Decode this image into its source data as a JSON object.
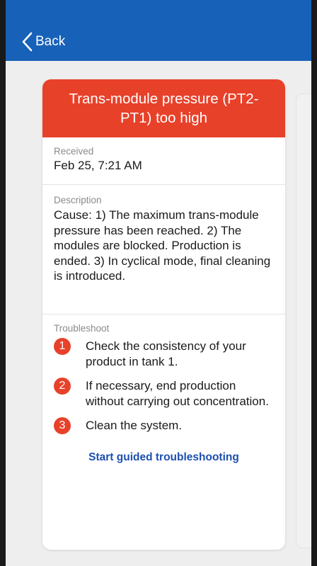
{
  "nav": {
    "back_label": "Back"
  },
  "colors": {
    "nav_bar": "#1762b8",
    "alert": "#e8412a",
    "link": "#1c4fb0"
  },
  "alarm": {
    "title": "Trans-module pressure (PT2-PT1) too high",
    "received_label": "Received",
    "received_value": "Feb 25, 7:21 AM",
    "description_label": "Description",
    "description": "Cause: 1) The maximum trans-module pressure has been reached. 2) The modules are blocked. Production is ended. 3) In cyclical mode, final cleaning is introduced.",
    "troubleshoot_label": "Troubleshoot",
    "steps": [
      {
        "num": "1",
        "text": "Check the consistency of your product in tank 1."
      },
      {
        "num": "2",
        "text": "If necessary, end production without carrying out concentration."
      },
      {
        "num": "3",
        "text": "Clean the system."
      }
    ],
    "cta_label": "Start guided troubleshooting"
  },
  "icons": {
    "back": "chevron-left-icon"
  }
}
